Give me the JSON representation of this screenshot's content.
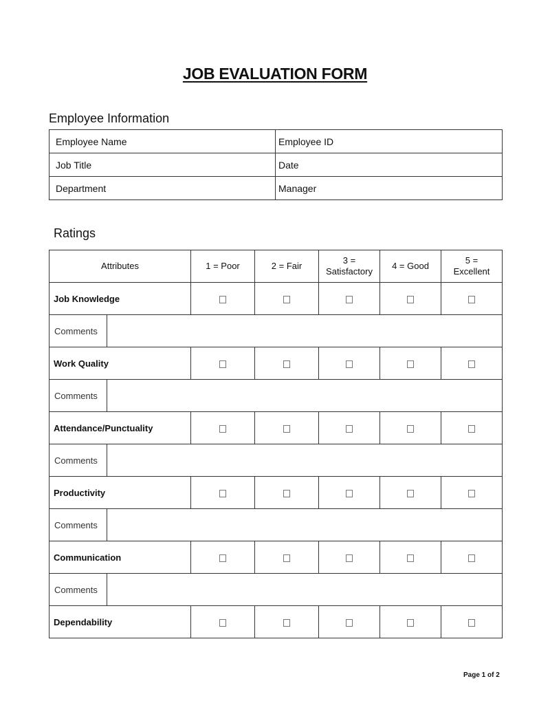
{
  "title": "JOB EVALUATION FORM",
  "employee_info": {
    "heading": "Employee Information",
    "rows": [
      {
        "left": "Employee Name",
        "right": "Employee ID"
      },
      {
        "left": "Job Title",
        "right": "Date"
      },
      {
        "left": "Department",
        "right": "Manager"
      }
    ]
  },
  "ratings": {
    "heading": "Ratings",
    "columns": {
      "attributes": "Attributes",
      "c1": "1 = Poor",
      "c2": "2 = Fair",
      "c3_line1": "3 =",
      "c3_line2": "Satisfactory",
      "c4": "4 = Good",
      "c5_line1": "5 =",
      "c5_line2": "Excellent"
    },
    "checkbox_icon": "empty-checkbox",
    "comments_label": "Comments",
    "attributes": [
      "Job Knowledge",
      "Work Quality",
      "Attendance/Punctuality",
      "Productivity",
      "Communication",
      "Dependability"
    ]
  },
  "footer": {
    "page": "Page 1 of 2"
  }
}
